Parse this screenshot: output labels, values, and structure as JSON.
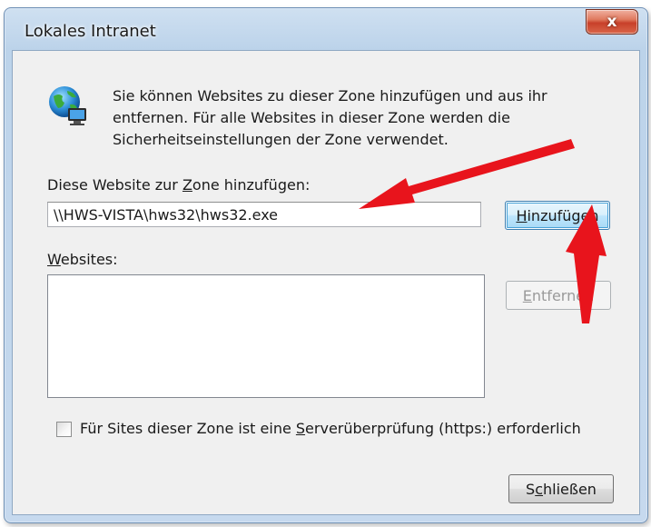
{
  "window": {
    "title": "Lokales Intranet",
    "close_glyph": "x"
  },
  "info": {
    "text": "Sie können Websites zu dieser Zone hinzufügen und aus ihr entfernen. Für alle Websites in dieser Zone werden die Sicherheitseinstellungen der Zone verwendet.",
    "icon": "globe-computer-icon"
  },
  "add_site": {
    "label_pre": "Diese Website zur ",
    "label_accel": "Z",
    "label_post": "one hinzufügen:",
    "value": "\\\\HWS-VISTA\\hws32\\hws32.exe",
    "add_button_accel": "H",
    "add_button_rest": "inzufügen"
  },
  "websites": {
    "label_accel": "W",
    "label_rest": "ebsites:",
    "remove_button_accel": "E",
    "remove_button_rest": "ntfernen",
    "items": []
  },
  "https_check": {
    "label_pre": "Für Sites dieser Zone ist eine ",
    "label_accel": "S",
    "label_post": "erverüberprüfung (https:) erforderlich",
    "checked": false
  },
  "footer": {
    "close_button_pre": "S",
    "close_button_accel": "c",
    "close_button_post": "hließen"
  },
  "annotations": {
    "arrow_color": "#e8141c",
    "arrow_icon": "red-arrow-icon"
  }
}
